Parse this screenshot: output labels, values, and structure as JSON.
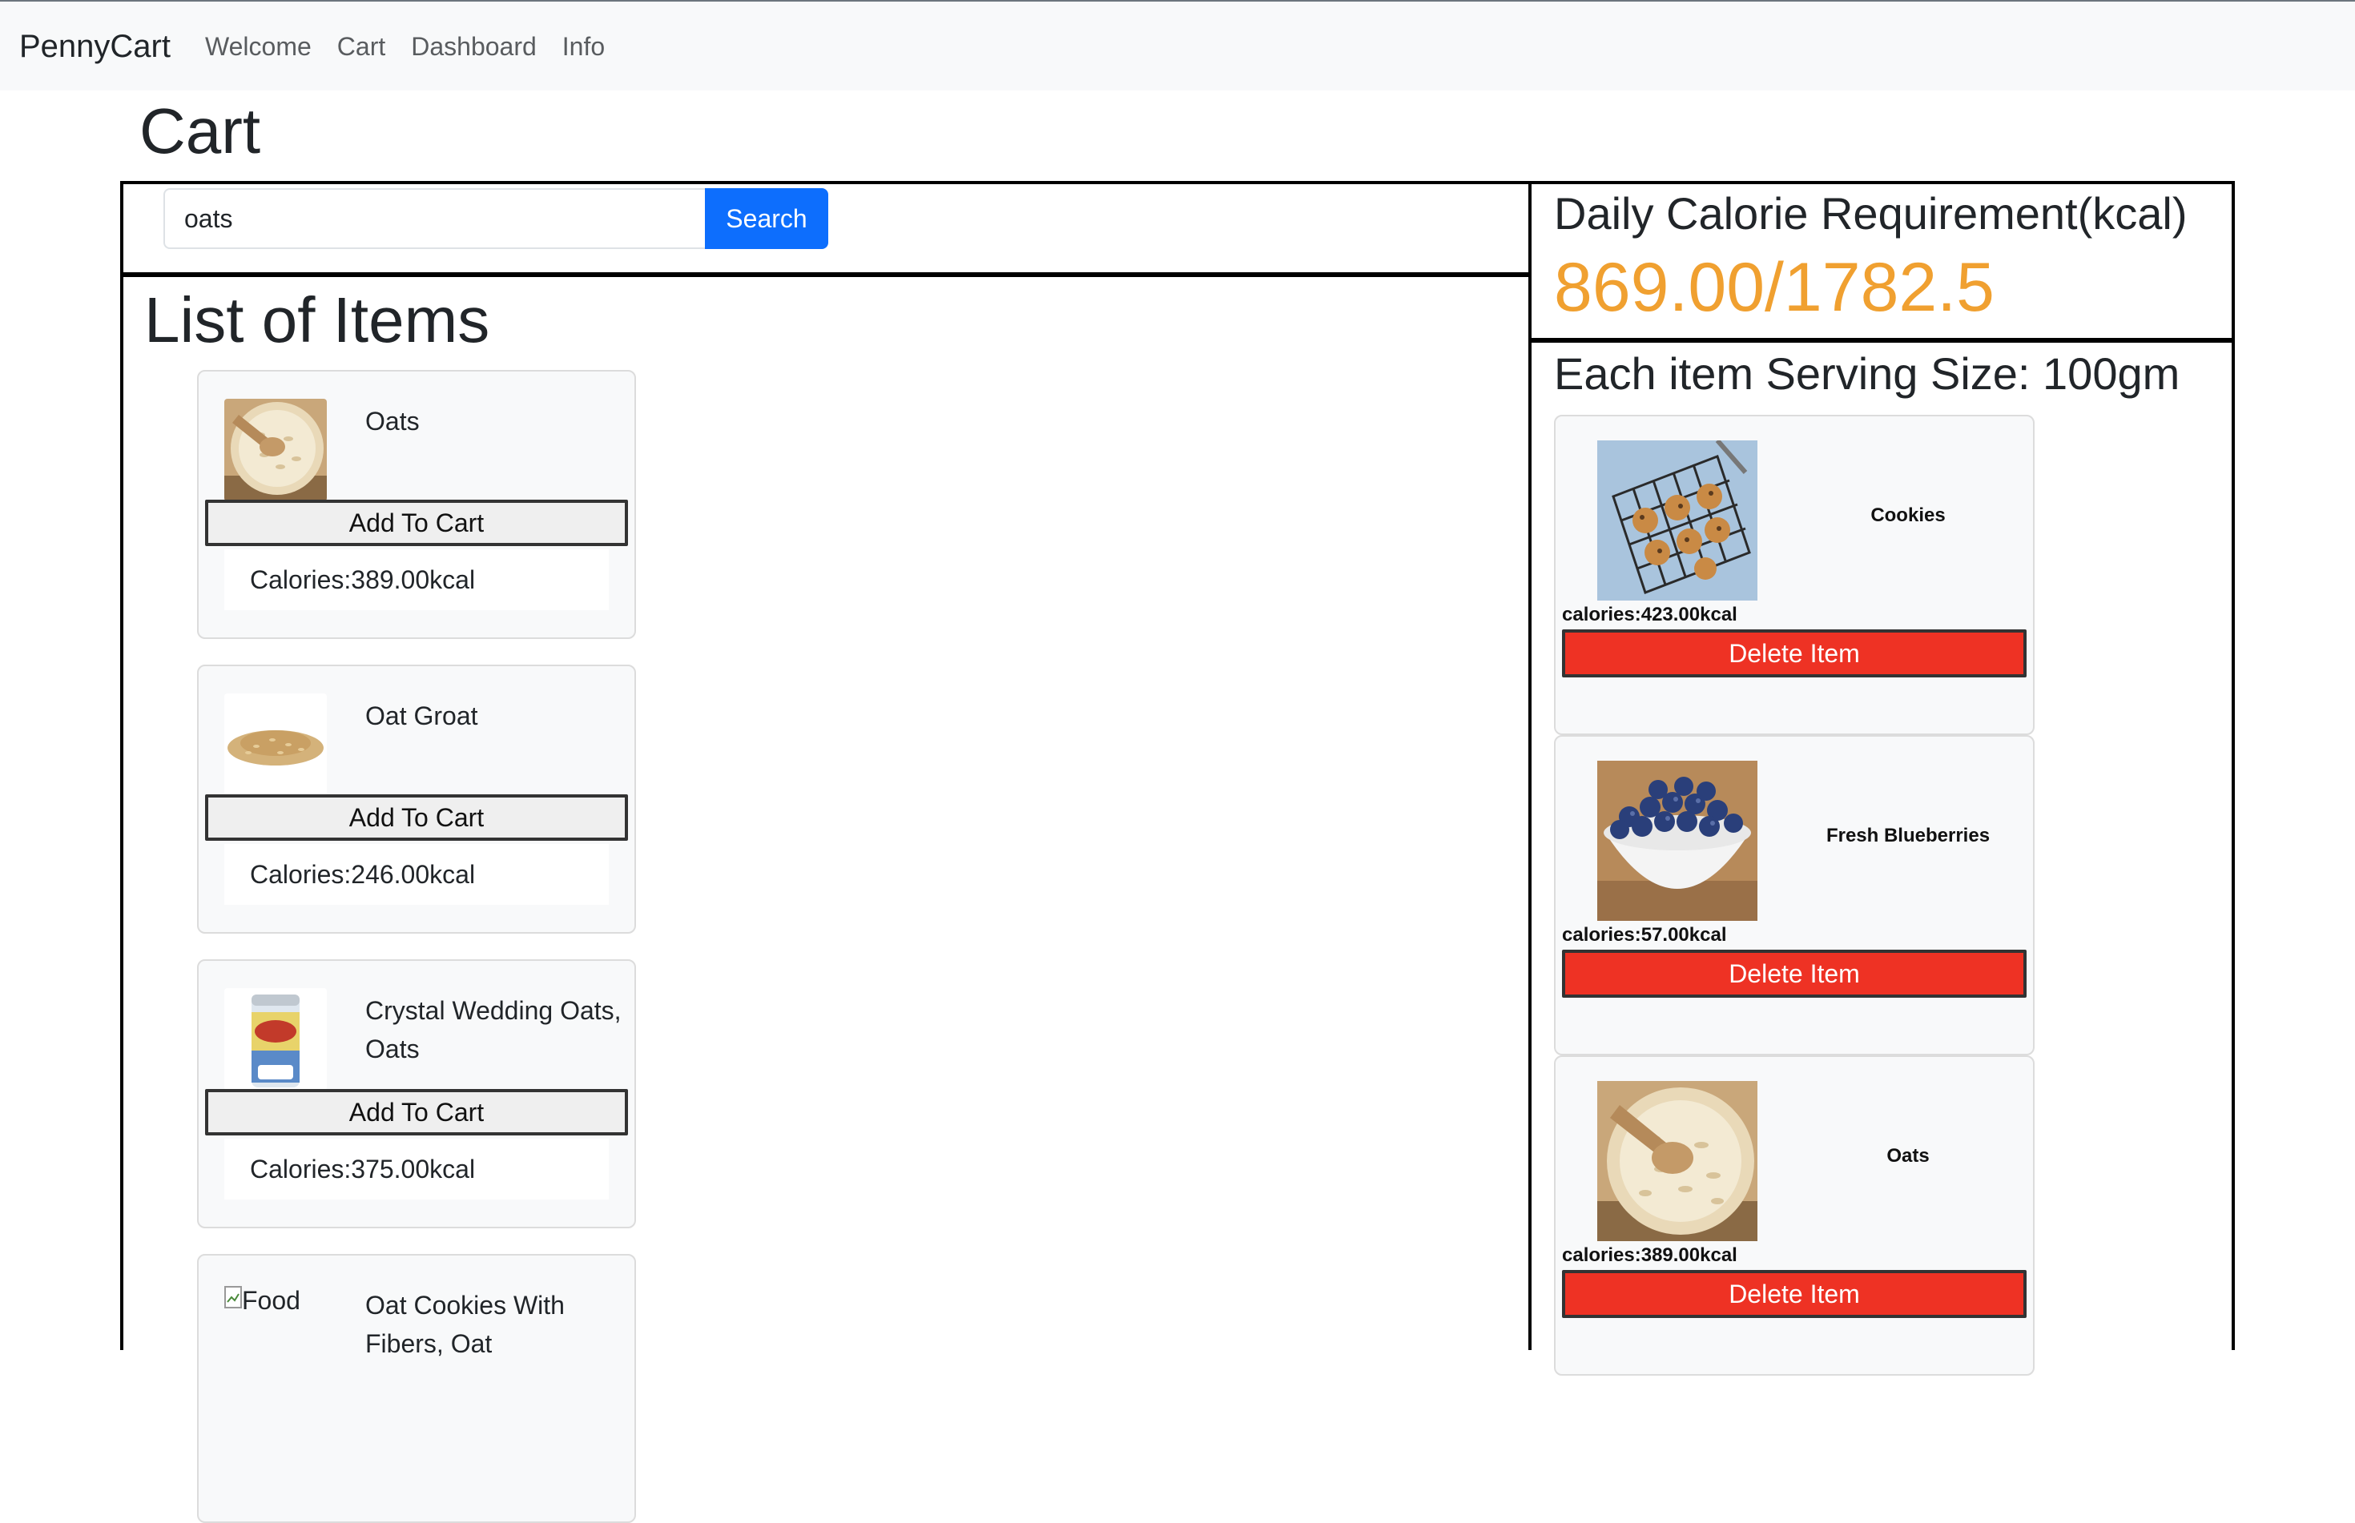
{
  "navbar": {
    "brand": "PennyCart",
    "links": [
      "Welcome",
      "Cart",
      "Dashboard",
      "Info"
    ]
  },
  "page": {
    "title": "Cart"
  },
  "search": {
    "value": "oats",
    "button_label": "Search"
  },
  "list": {
    "title": "List of Items",
    "add_label": "Add To Cart",
    "broken_image_alt": "Food",
    "items": [
      {
        "name": "Oats",
        "calories": "Calories:389.00kcal",
        "image": "oats-bowl"
      },
      {
        "name": "Oat Groat",
        "calories": "Calories:246.00kcal",
        "image": "oat-groat-pile"
      },
      {
        "name": "Crystal Wedding Oats, Oats",
        "calories": "Calories:375.00kcal",
        "image": "oats-canister"
      },
      {
        "name": "Oat Cookies With Fibers, Oat",
        "calories": "",
        "image": "broken"
      }
    ]
  },
  "calorie": {
    "title": "Daily Calorie Requirement(kcal)",
    "value": "869.00/1782.5",
    "accent_color": "#f0a030"
  },
  "cart": {
    "serving_title": "Each item Serving Size: 100gm",
    "delete_label": "Delete Item",
    "delete_color": "#ee3224",
    "items": [
      {
        "name": "Cookies",
        "calories": "calories:423.00kcal",
        "image": "cookies-rack"
      },
      {
        "name": "Fresh Blueberries",
        "calories": "calories:57.00kcal",
        "image": "blueberries-bowl"
      },
      {
        "name": "Oats",
        "calories": "calories:389.00kcal",
        "image": "oats-bowl"
      }
    ]
  }
}
